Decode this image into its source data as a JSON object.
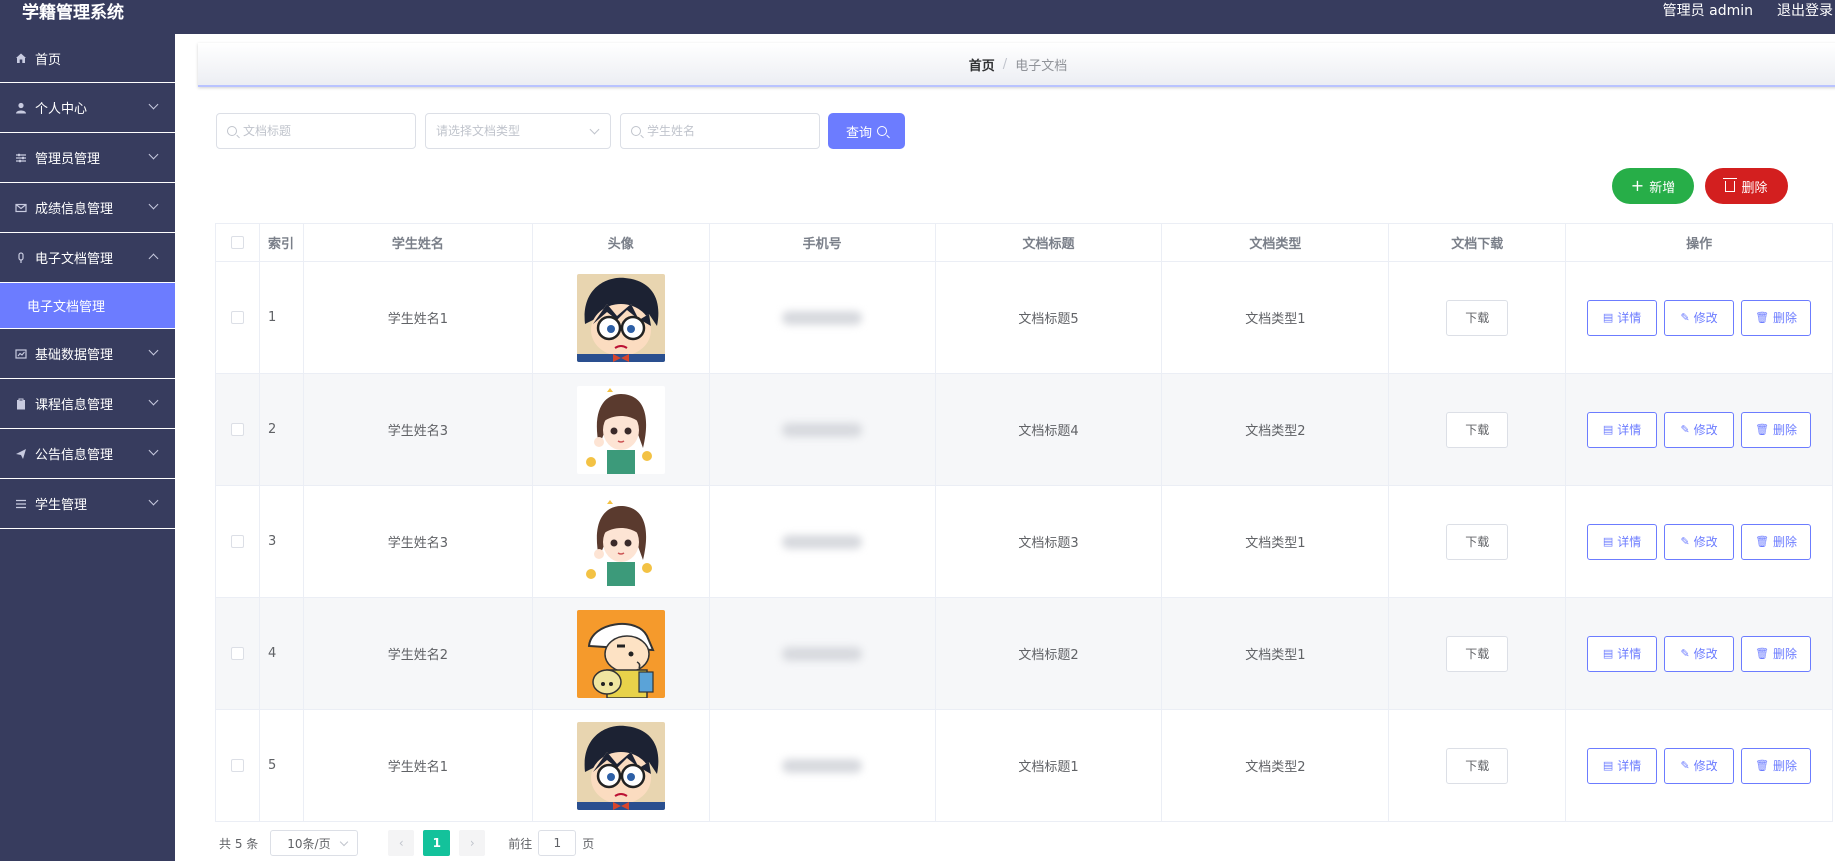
{
  "header": {
    "app_title": "学籍管理系统",
    "user_info": "管理员 admin",
    "logout": "退出登录"
  },
  "sidebar": {
    "items": [
      {
        "label": "首页",
        "icon": "home-icon"
      },
      {
        "label": "个人中心",
        "icon": "user-icon"
      },
      {
        "label": "管理员管理",
        "icon": "sliders-icon"
      },
      {
        "label": "成绩信息管理",
        "icon": "mail-icon"
      },
      {
        "label": "电子文档管理",
        "icon": "mic-icon"
      },
      {
        "label": "基础数据管理",
        "icon": "chart-icon"
      },
      {
        "label": "课程信息管理",
        "icon": "clipboard-icon"
      },
      {
        "label": "公告信息管理",
        "icon": "send-icon"
      },
      {
        "label": "学生管理",
        "icon": "list-icon"
      }
    ],
    "active_sub": "电子文档管理"
  },
  "breadcrumb": {
    "home": "首页",
    "separator": "/",
    "current": "电子文档"
  },
  "search": {
    "title_placeholder": "文档标题",
    "type_placeholder": "请选择文档类型",
    "name_placeholder": "学生姓名",
    "query_label": "查询"
  },
  "actions": {
    "add_label": "新增",
    "delete_label": "删除"
  },
  "table": {
    "headers": [
      "索引",
      "学生姓名",
      "头像",
      "手机号",
      "文档标题",
      "文档类型",
      "文档下载",
      "操作"
    ],
    "rows": [
      {
        "index": "1",
        "name": "学生姓名1",
        "avatar": "conan",
        "title": "文档标题5",
        "type": "文档类型1"
      },
      {
        "index": "2",
        "name": "学生姓名3",
        "avatar": "girl",
        "title": "文档标题4",
        "type": "文档类型2"
      },
      {
        "index": "3",
        "name": "学生姓名3",
        "avatar": "girl",
        "title": "文档标题3",
        "type": "文档类型1"
      },
      {
        "index": "4",
        "name": "学生姓名2",
        "avatar": "shin",
        "title": "文档标题2",
        "type": "文档类型1"
      },
      {
        "index": "5",
        "name": "学生姓名1",
        "avatar": "conan",
        "title": "文档标题1",
        "type": "文档类型2"
      }
    ],
    "download_label": "下载",
    "op_detail": "详情",
    "op_edit": "修改",
    "op_delete": "删除"
  },
  "pagination": {
    "total": "共 5 条",
    "page_size": "10条/页",
    "current_page": "1",
    "goto_label": "前往",
    "goto_value": "1",
    "page_suffix": "页"
  },
  "colors": {
    "sidebar": "#373c5e",
    "accent": "#6c7cff",
    "add": "#27ae48",
    "delete": "#d31f1f",
    "page_active": "#13c29b"
  }
}
